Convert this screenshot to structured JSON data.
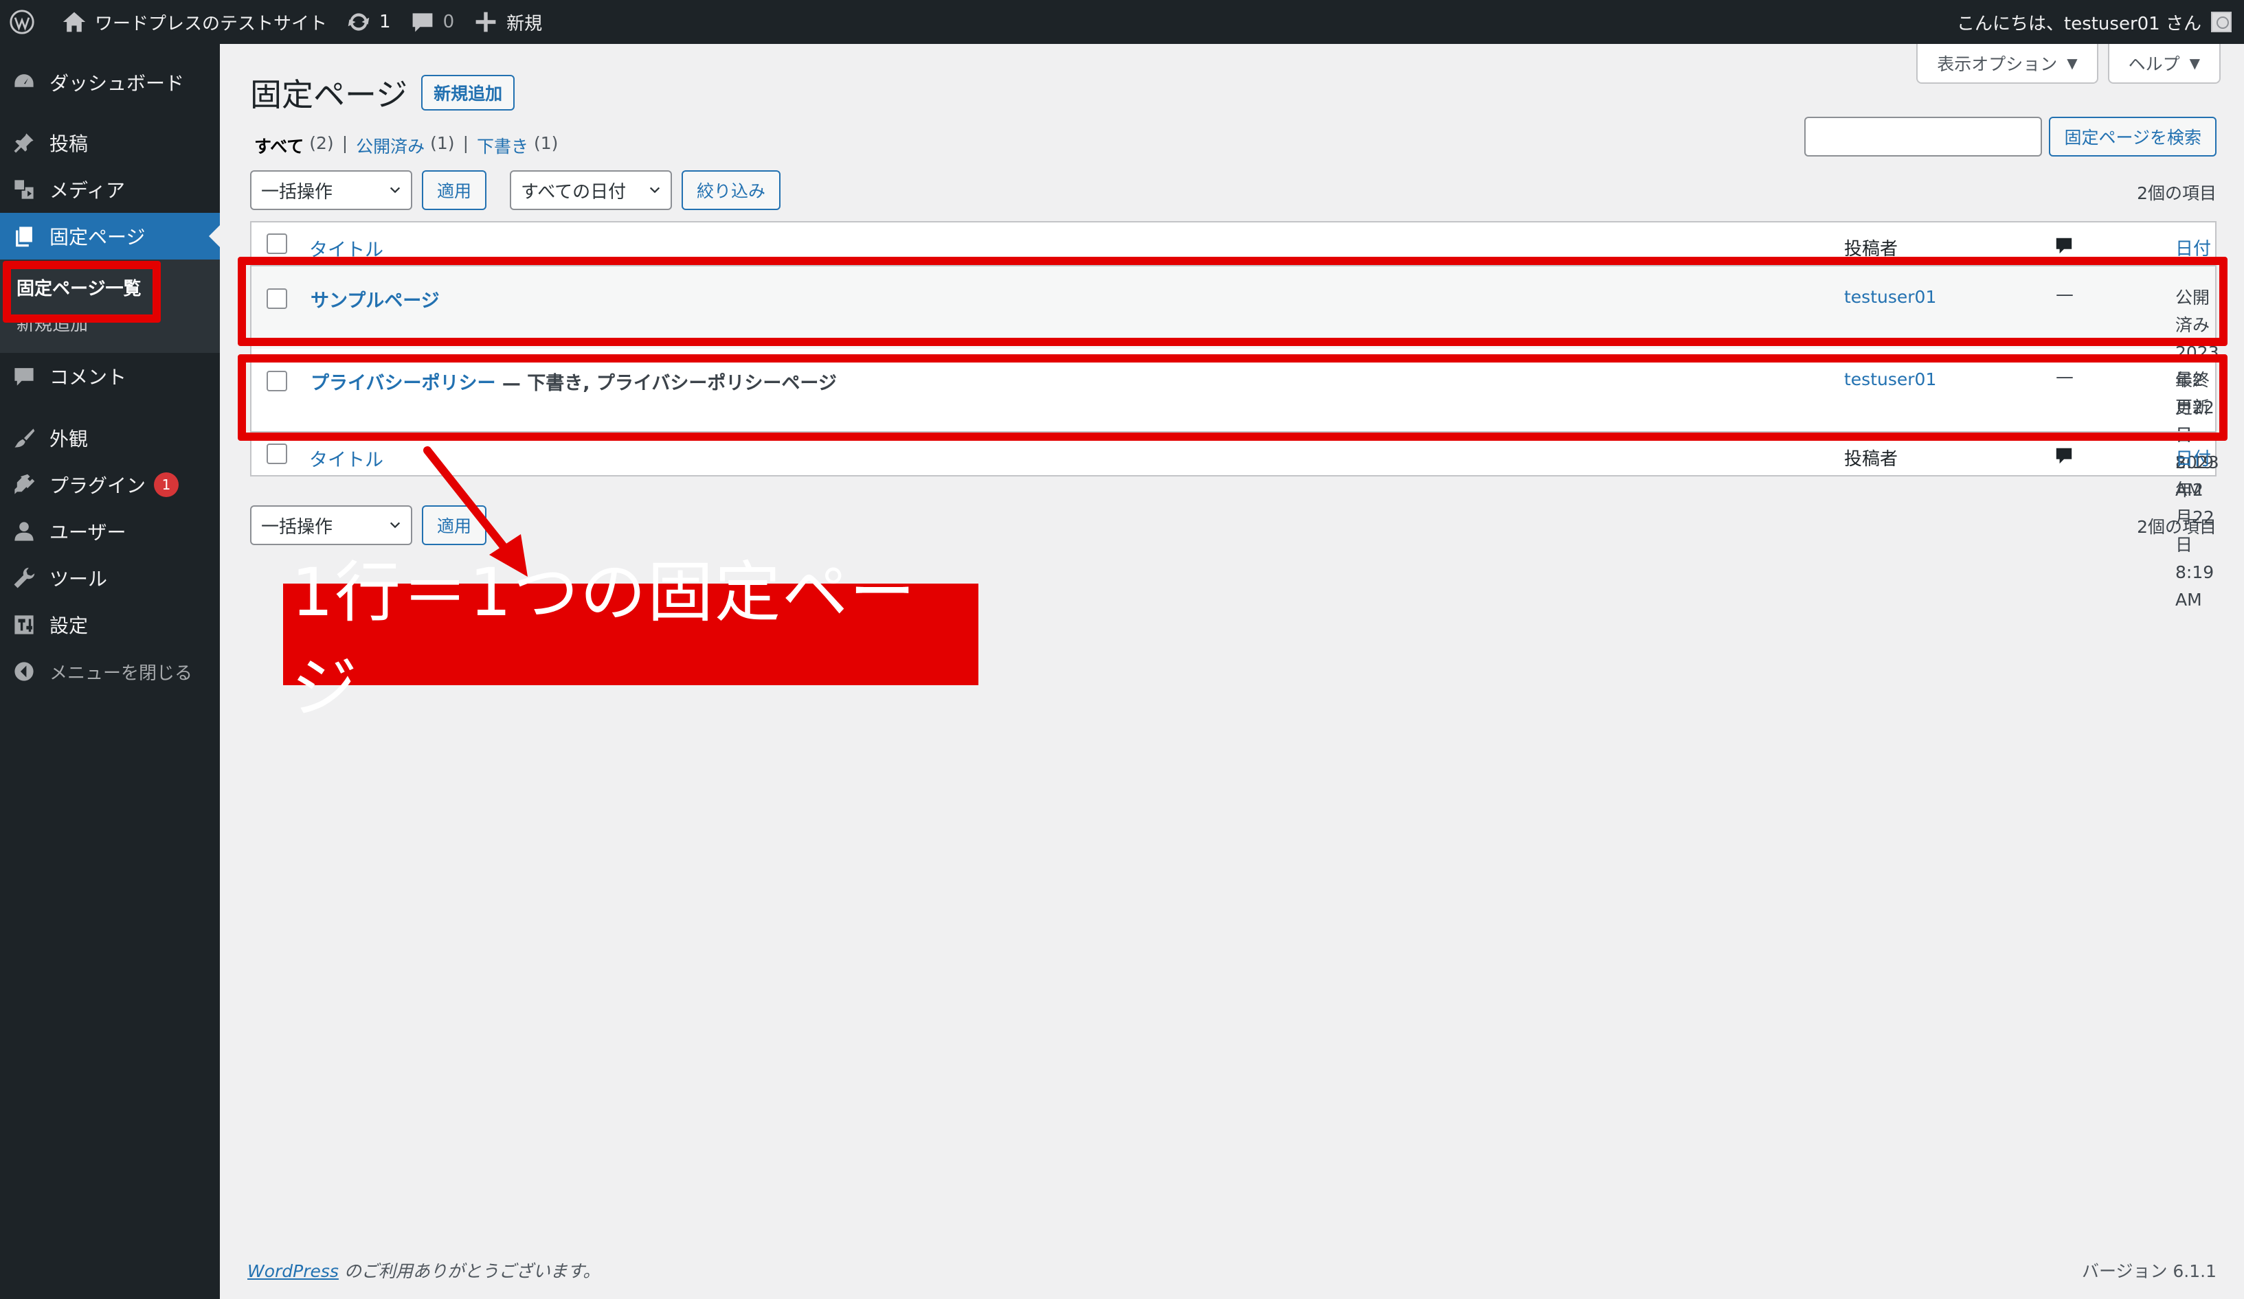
{
  "adminbar": {
    "site_name": "ワードプレスのテストサイト",
    "updates_count": "1",
    "comments_count": "0",
    "new_label": "新規",
    "greeting": "こんにちは、testuser01 さん"
  },
  "sidebar": {
    "items": [
      {
        "label": "ダッシュボード",
        "icon": "dashboard-icon"
      },
      {
        "label": "投稿",
        "icon": "pin-icon"
      },
      {
        "label": "メディア",
        "icon": "media-icon"
      },
      {
        "label": "固定ページ",
        "icon": "pages-icon"
      },
      {
        "label": "コメント",
        "icon": "comment-icon"
      },
      {
        "label": "外観",
        "icon": "brush-icon"
      },
      {
        "label": "プラグイン",
        "icon": "plugin-icon",
        "badge": "1"
      },
      {
        "label": "ユーザー",
        "icon": "user-icon"
      },
      {
        "label": "ツール",
        "icon": "wrench-icon"
      },
      {
        "label": "設定",
        "icon": "settings-icon"
      },
      {
        "label": "メニューを閉じる",
        "icon": "collapse-icon"
      }
    ],
    "submenu": [
      {
        "label": "固定ページ一覧"
      },
      {
        "label": "新規追加"
      }
    ]
  },
  "screen_tabs": {
    "options": "表示オプション",
    "help": "ヘルプ"
  },
  "page": {
    "title": "固定ページ",
    "add_new": "新規追加"
  },
  "filters": {
    "all": "すべて",
    "all_count": "(2)",
    "published": "公開済み",
    "published_count": "(1)",
    "draft": "下書き",
    "draft_count": "(1)",
    "separator": "|"
  },
  "search": {
    "button": "固定ページを検索",
    "value": ""
  },
  "tablenav": {
    "bulk_action": "一括操作",
    "apply": "適用",
    "date_filter": "すべての日付",
    "filter_button": "絞り込み",
    "items_count": "2個の項目"
  },
  "table": {
    "columns": {
      "title": "タイトル",
      "author": "投稿者",
      "date": "日付"
    },
    "rows": [
      {
        "title": "サンプルページ",
        "state": "",
        "author": "testuser01",
        "comments": "—",
        "date_status": "公開済み",
        "date": "2023年2月22日 8:19 AM"
      },
      {
        "title": "プライバシーポリシー",
        "state": " — 下書き, プライバシーポリシーページ",
        "author": "testuser01",
        "comments": "—",
        "date_status": "最終更新日",
        "date": "2023年2月22日 8:19 AM"
      }
    ]
  },
  "annotation": {
    "callout": "1行＝1つの固定ページ"
  },
  "footer": {
    "wp_link": "WordPress",
    "thanks": " のご利用ありがとうございます。",
    "version": "バージョン 6.1.1"
  },
  "colors": {
    "admin_dark": "#1d2327",
    "accent": "#2271b1",
    "annotation_red": "#e30000"
  }
}
